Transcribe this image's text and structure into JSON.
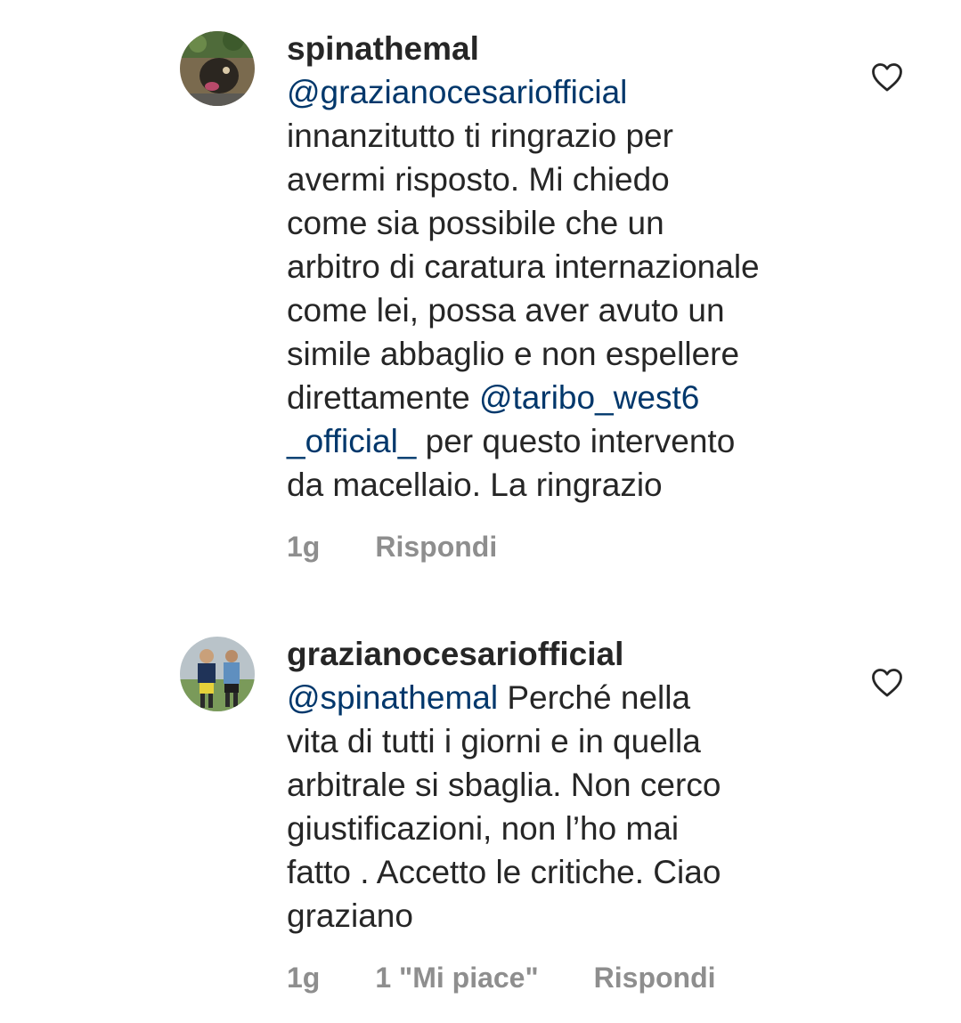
{
  "comments": [
    {
      "username": "spinathemal",
      "lines": [
        [
          {
            "text": "@grazianocesariofficial",
            "mention": true
          }
        ],
        [
          {
            "text": "innanzitutto ti ringrazio per",
            "mention": false
          }
        ],
        [
          {
            "text": "avermi risposto. Mi chiedo",
            "mention": false
          }
        ],
        [
          {
            "text": "come sia possibile che un",
            "mention": false
          }
        ],
        [
          {
            "text": "arbitro di caratura internazionale",
            "mention": false
          }
        ],
        [
          {
            "text": "come lei, possa aver avuto un",
            "mention": false
          }
        ],
        [
          {
            "text": "simile abbaglio e non espellere",
            "mention": false
          }
        ],
        [
          {
            "text": "direttamente ",
            "mention": false
          },
          {
            "text": "@taribo_west6",
            "mention": true
          }
        ],
        [
          {
            "text": "_official_",
            "mention": true
          },
          {
            "text": " per questo intervento",
            "mention": false
          }
        ],
        [
          {
            "text": "da macellaio. La ringrazio",
            "mention": false
          }
        ]
      ],
      "time": "1g",
      "likes": "",
      "reply_label": "Rispondi",
      "avatar_icon": "user-avatar-photo",
      "like_icon": "heart-outline-icon"
    },
    {
      "username": "grazianocesariofficial",
      "lines": [
        [
          {
            "text": "@spinathemal",
            "mention": true
          },
          {
            "text": " Perché nella",
            "mention": false
          }
        ],
        [
          {
            "text": "vita di tutti i giorni e in quella",
            "mention": false
          }
        ],
        [
          {
            "text": "arbitrale si sbaglia. Non cerco",
            "mention": false
          }
        ],
        [
          {
            "text": "giustificazioni, non l’ho mai",
            "mention": false
          }
        ],
        [
          {
            "text": "fatto . Accetto le critiche. Ciao",
            "mention": false
          }
        ],
        [
          {
            "text": "graziano",
            "mention": false
          }
        ]
      ],
      "time": "1g",
      "likes": "1 \"Mi piace\"",
      "reply_label": "Rispondi",
      "avatar_icon": "user-avatar-photo",
      "like_icon": "heart-outline-icon"
    }
  ],
  "colors": {
    "text": "#262626",
    "mention": "#00376b",
    "meta": "#8e8e8e",
    "background": "#ffffff"
  }
}
